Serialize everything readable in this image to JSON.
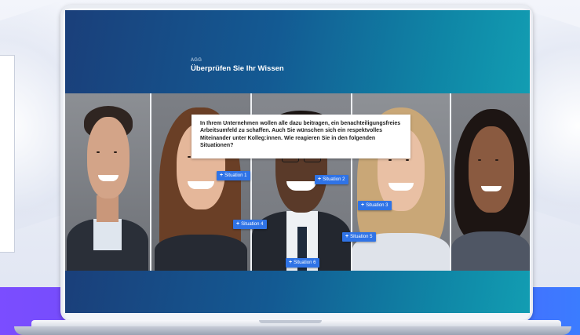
{
  "lesson": {
    "kicker": "AGG",
    "title": "Überprüfen Sie Ihr Wissen",
    "question": "In Ihrem Unternehmen wollen alle dazu beitragen, ein benachteiligungsfreies Arbeitsumfeld zu schaffen. Auch Sie wünschen sich ein respektvolles Miteinander unter Kolleg:innen. Wie reagieren Sie in den folgenden Situationen?"
  },
  "hotspots": [
    {
      "label": "Situation 1",
      "icon": "plus-icon"
    },
    {
      "label": "Situation 2",
      "icon": "plus-icon"
    },
    {
      "label": "Situation 3",
      "icon": "plus-icon"
    },
    {
      "label": "Situation 4",
      "icon": "plus-icon"
    },
    {
      "label": "Situation 5",
      "icon": "plus-icon"
    },
    {
      "label": "Situation 6",
      "icon": "plus-icon"
    }
  ],
  "colors": {
    "header_gradient_start": "#1a3f7a",
    "header_gradient_end": "#129db2",
    "hotspot": "#2f73e6",
    "band_start": "#7b4dff",
    "band_end": "#3b7cff"
  }
}
